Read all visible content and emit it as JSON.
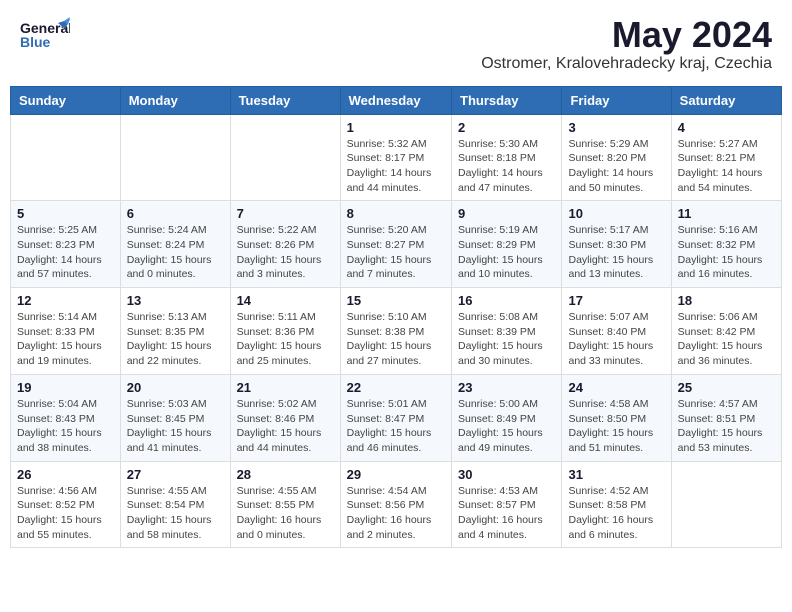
{
  "header": {
    "logo_general": "General",
    "logo_blue": "Blue",
    "month": "May 2024",
    "location": "Ostromer, Kralovehradecky kraj, Czechia"
  },
  "weekdays": [
    "Sunday",
    "Monday",
    "Tuesday",
    "Wednesday",
    "Thursday",
    "Friday",
    "Saturday"
  ],
  "weeks": [
    [
      {
        "day": "",
        "sunrise": "",
        "sunset": "",
        "daylight": ""
      },
      {
        "day": "",
        "sunrise": "",
        "sunset": "",
        "daylight": ""
      },
      {
        "day": "",
        "sunrise": "",
        "sunset": "",
        "daylight": ""
      },
      {
        "day": "1",
        "sunrise": "Sunrise: 5:32 AM",
        "sunset": "Sunset: 8:17 PM",
        "daylight": "Daylight: 14 hours and 44 minutes."
      },
      {
        "day": "2",
        "sunrise": "Sunrise: 5:30 AM",
        "sunset": "Sunset: 8:18 PM",
        "daylight": "Daylight: 14 hours and 47 minutes."
      },
      {
        "day": "3",
        "sunrise": "Sunrise: 5:29 AM",
        "sunset": "Sunset: 8:20 PM",
        "daylight": "Daylight: 14 hours and 50 minutes."
      },
      {
        "day": "4",
        "sunrise": "Sunrise: 5:27 AM",
        "sunset": "Sunset: 8:21 PM",
        "daylight": "Daylight: 14 hours and 54 minutes."
      }
    ],
    [
      {
        "day": "5",
        "sunrise": "Sunrise: 5:25 AM",
        "sunset": "Sunset: 8:23 PM",
        "daylight": "Daylight: 14 hours and 57 minutes."
      },
      {
        "day": "6",
        "sunrise": "Sunrise: 5:24 AM",
        "sunset": "Sunset: 8:24 PM",
        "daylight": "Daylight: 15 hours and 0 minutes."
      },
      {
        "day": "7",
        "sunrise": "Sunrise: 5:22 AM",
        "sunset": "Sunset: 8:26 PM",
        "daylight": "Daylight: 15 hours and 3 minutes."
      },
      {
        "day": "8",
        "sunrise": "Sunrise: 5:20 AM",
        "sunset": "Sunset: 8:27 PM",
        "daylight": "Daylight: 15 hours and 7 minutes."
      },
      {
        "day": "9",
        "sunrise": "Sunrise: 5:19 AM",
        "sunset": "Sunset: 8:29 PM",
        "daylight": "Daylight: 15 hours and 10 minutes."
      },
      {
        "day": "10",
        "sunrise": "Sunrise: 5:17 AM",
        "sunset": "Sunset: 8:30 PM",
        "daylight": "Daylight: 15 hours and 13 minutes."
      },
      {
        "day": "11",
        "sunrise": "Sunrise: 5:16 AM",
        "sunset": "Sunset: 8:32 PM",
        "daylight": "Daylight: 15 hours and 16 minutes."
      }
    ],
    [
      {
        "day": "12",
        "sunrise": "Sunrise: 5:14 AM",
        "sunset": "Sunset: 8:33 PM",
        "daylight": "Daylight: 15 hours and 19 minutes."
      },
      {
        "day": "13",
        "sunrise": "Sunrise: 5:13 AM",
        "sunset": "Sunset: 8:35 PM",
        "daylight": "Daylight: 15 hours and 22 minutes."
      },
      {
        "day": "14",
        "sunrise": "Sunrise: 5:11 AM",
        "sunset": "Sunset: 8:36 PM",
        "daylight": "Daylight: 15 hours and 25 minutes."
      },
      {
        "day": "15",
        "sunrise": "Sunrise: 5:10 AM",
        "sunset": "Sunset: 8:38 PM",
        "daylight": "Daylight: 15 hours and 27 minutes."
      },
      {
        "day": "16",
        "sunrise": "Sunrise: 5:08 AM",
        "sunset": "Sunset: 8:39 PM",
        "daylight": "Daylight: 15 hours and 30 minutes."
      },
      {
        "day": "17",
        "sunrise": "Sunrise: 5:07 AM",
        "sunset": "Sunset: 8:40 PM",
        "daylight": "Daylight: 15 hours and 33 minutes."
      },
      {
        "day": "18",
        "sunrise": "Sunrise: 5:06 AM",
        "sunset": "Sunset: 8:42 PM",
        "daylight": "Daylight: 15 hours and 36 minutes."
      }
    ],
    [
      {
        "day": "19",
        "sunrise": "Sunrise: 5:04 AM",
        "sunset": "Sunset: 8:43 PM",
        "daylight": "Daylight: 15 hours and 38 minutes."
      },
      {
        "day": "20",
        "sunrise": "Sunrise: 5:03 AM",
        "sunset": "Sunset: 8:45 PM",
        "daylight": "Daylight: 15 hours and 41 minutes."
      },
      {
        "day": "21",
        "sunrise": "Sunrise: 5:02 AM",
        "sunset": "Sunset: 8:46 PM",
        "daylight": "Daylight: 15 hours and 44 minutes."
      },
      {
        "day": "22",
        "sunrise": "Sunrise: 5:01 AM",
        "sunset": "Sunset: 8:47 PM",
        "daylight": "Daylight: 15 hours and 46 minutes."
      },
      {
        "day": "23",
        "sunrise": "Sunrise: 5:00 AM",
        "sunset": "Sunset: 8:49 PM",
        "daylight": "Daylight: 15 hours and 49 minutes."
      },
      {
        "day": "24",
        "sunrise": "Sunrise: 4:58 AM",
        "sunset": "Sunset: 8:50 PM",
        "daylight": "Daylight: 15 hours and 51 minutes."
      },
      {
        "day": "25",
        "sunrise": "Sunrise: 4:57 AM",
        "sunset": "Sunset: 8:51 PM",
        "daylight": "Daylight: 15 hours and 53 minutes."
      }
    ],
    [
      {
        "day": "26",
        "sunrise": "Sunrise: 4:56 AM",
        "sunset": "Sunset: 8:52 PM",
        "daylight": "Daylight: 15 hours and 55 minutes."
      },
      {
        "day": "27",
        "sunrise": "Sunrise: 4:55 AM",
        "sunset": "Sunset: 8:54 PM",
        "daylight": "Daylight: 15 hours and 58 minutes."
      },
      {
        "day": "28",
        "sunrise": "Sunrise: 4:55 AM",
        "sunset": "Sunset: 8:55 PM",
        "daylight": "Daylight: 16 hours and 0 minutes."
      },
      {
        "day": "29",
        "sunrise": "Sunrise: 4:54 AM",
        "sunset": "Sunset: 8:56 PM",
        "daylight": "Daylight: 16 hours and 2 minutes."
      },
      {
        "day": "30",
        "sunrise": "Sunrise: 4:53 AM",
        "sunset": "Sunset: 8:57 PM",
        "daylight": "Daylight: 16 hours and 4 minutes."
      },
      {
        "day": "31",
        "sunrise": "Sunrise: 4:52 AM",
        "sunset": "Sunset: 8:58 PM",
        "daylight": "Daylight: 16 hours and 6 minutes."
      },
      {
        "day": "",
        "sunrise": "",
        "sunset": "",
        "daylight": ""
      }
    ]
  ]
}
